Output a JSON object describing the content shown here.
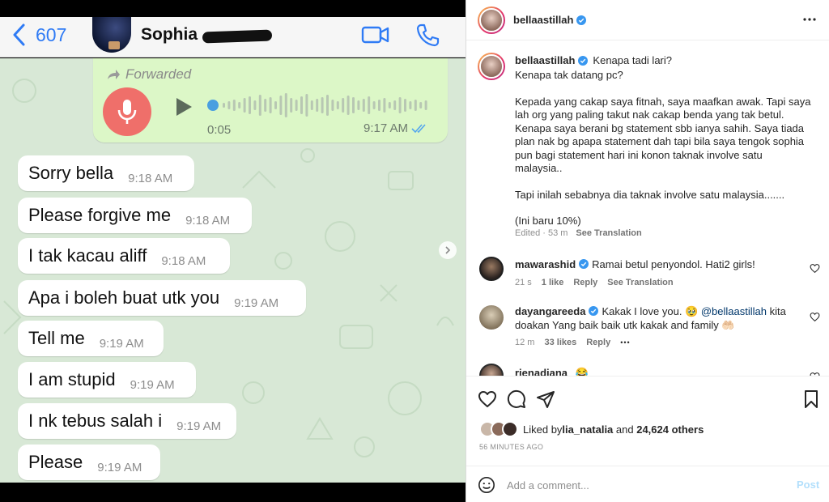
{
  "whatsapp": {
    "back_count": "607",
    "contact_name": "Sophia",
    "voice_message": {
      "forwarded_label": "Forwarded",
      "duration": "0:05",
      "time": "9:17 AM"
    },
    "messages": [
      {
        "text": "Sorry bella",
        "time": "9:18 AM"
      },
      {
        "text": "Please forgive me",
        "time": "9:18 AM"
      },
      {
        "text": "I tak kacau aliff",
        "time": "9:18 AM"
      },
      {
        "text": "Apa i boleh buat utk you",
        "time": "9:19 AM"
      },
      {
        "text": "Tell me",
        "time": "9:19 AM"
      },
      {
        "text": "I am stupid",
        "time": "9:19 AM"
      },
      {
        "text": "I nk tebus salah i",
        "time": "9:19 AM"
      },
      {
        "text": "Please",
        "time": "9:19 AM"
      }
    ],
    "colors": {
      "header_blue": "#2f7bf5",
      "outgoing_bubble": "#dcf7c7",
      "chat_bg": "#d8e8d6",
      "mic_red": "#ef6f6a"
    }
  },
  "instagram": {
    "username": "bellaastillah",
    "caption": {
      "first_line": "Kenapa tadi lari?",
      "lines_block1": [
        "Kenapa tak datang pc?"
      ],
      "paragraph2": [
        "Kepada yang cakap saya fitnah, saya maafkan awak. Tapi saya",
        "lah org yang paling takut nak cakap benda yang tak betul.",
        "Kenapa saya berani bg statement sbb ianya sahih. Saya tiada",
        "plan nak bg apapa statement dah tapi bila saya tengok sophia",
        "pun bagi statement hari ini konon taknak involve satu",
        "malaysia.."
      ],
      "paragraph3": "Tapi inilah sebabnya dia taknak involve satu malaysia.......",
      "paragraph4": "(Ini baru 10%)",
      "edited": "Edited · 53 m",
      "see_translation": "See Translation"
    },
    "comments": [
      {
        "user": "mawarashid",
        "text": "Ramai betul penyondol. Hati2 girls!",
        "time": "21 s",
        "likes": "1 like",
        "reply": "Reply",
        "see_translation": "See Translation"
      },
      {
        "user": "dayangareeda",
        "text_before": "Kakak I love you. 🥹 ",
        "mention": "@bellaastillah",
        "text_after": " kita",
        "text_line2": "doakan Yang baik baik utk kakak and family 🤲🏻",
        "time": "12 m",
        "likes": "33 likes",
        "reply": "Reply",
        "more": "•••"
      },
      {
        "user": "rienadiana",
        "text": "😂"
      }
    ],
    "liked_by_prefix": "Liked by ",
    "liked_by_user": "lia_natalia",
    "liked_by_mid": " and ",
    "liked_by_others": "24,624 others",
    "time_ago": "56 MINUTES AGO",
    "comment_placeholder": "Add a comment...",
    "post_label": "Post",
    "colors": {
      "verified": "#3897f0",
      "post_button_disabled": "#b2dffc"
    }
  }
}
